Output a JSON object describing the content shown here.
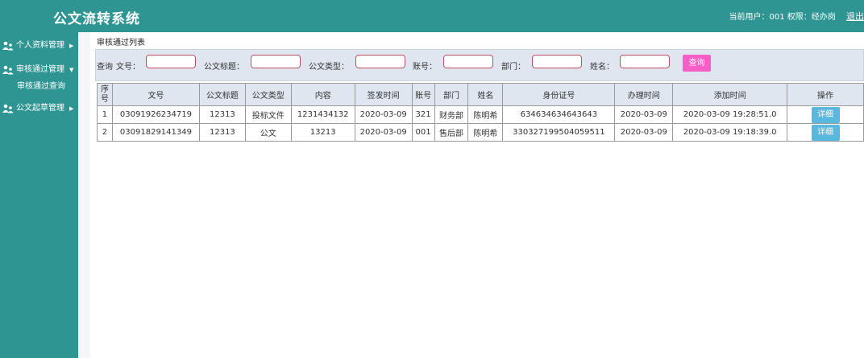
{
  "header": {
    "app_title": "公文流转系统",
    "user_info": "当前用户：001  权限：经办岗",
    "logout": "退出"
  },
  "sidebar": {
    "items": [
      {
        "label": "个人资料管理",
        "arrow": "▶",
        "icon": "user-group-icon"
      },
      {
        "label": "审核通过管理",
        "arrow": "▼",
        "icon": "user-group-icon"
      },
      {
        "label": "公文起草管理",
        "arrow": "▶",
        "icon": "user-group-icon"
      }
    ],
    "sub_items": [
      {
        "label": "审核通过查询"
      }
    ]
  },
  "main": {
    "section_title": "审核通过列表",
    "filter": {
      "query_label": "查询",
      "doc_no_label": "文号：",
      "doc_title_label": "公文标题：",
      "doc_type_label": "公文类型：",
      "account_label": "账号：",
      "dept_label": "部门：",
      "name_label": "姓名：",
      "query_button": "查询"
    },
    "table": {
      "headers": [
        "序号",
        "文号",
        "公文标题",
        "公文类型",
        "内容",
        "签发时间",
        "账号",
        "部门",
        "姓名",
        "身份证号",
        "办理时间",
        "添加时间",
        "操作"
      ],
      "rows": [
        {
          "no": "1",
          "doc_no": "03091926234719",
          "title": "12313",
          "type": "投标文件",
          "content": "1231434132",
          "issue_time": "2020-03-09",
          "account": "321",
          "dept": "财务部",
          "name": "陈明希",
          "id_card": "634634634643643",
          "handle_time": "2020-03-09",
          "add_time": "2020-03-09 19:28:51.0",
          "action": "详细"
        },
        {
          "no": "2",
          "doc_no": "03091829141349",
          "title": "12313",
          "type": "公文",
          "content": "13213",
          "issue_time": "2020-03-09",
          "account": "001",
          "dept": "售后部",
          "name": "陈明希",
          "id_card": "330327199504059511",
          "handle_time": "2020-03-09",
          "add_time": "2020-03-09 19:18:39.0",
          "action": "详细"
        }
      ]
    }
  },
  "colors": {
    "teal": "#2e9593",
    "query_button": "#f85fc6",
    "detail_button": "#58b8dd",
    "filter_bg": "#dfe6ef"
  }
}
